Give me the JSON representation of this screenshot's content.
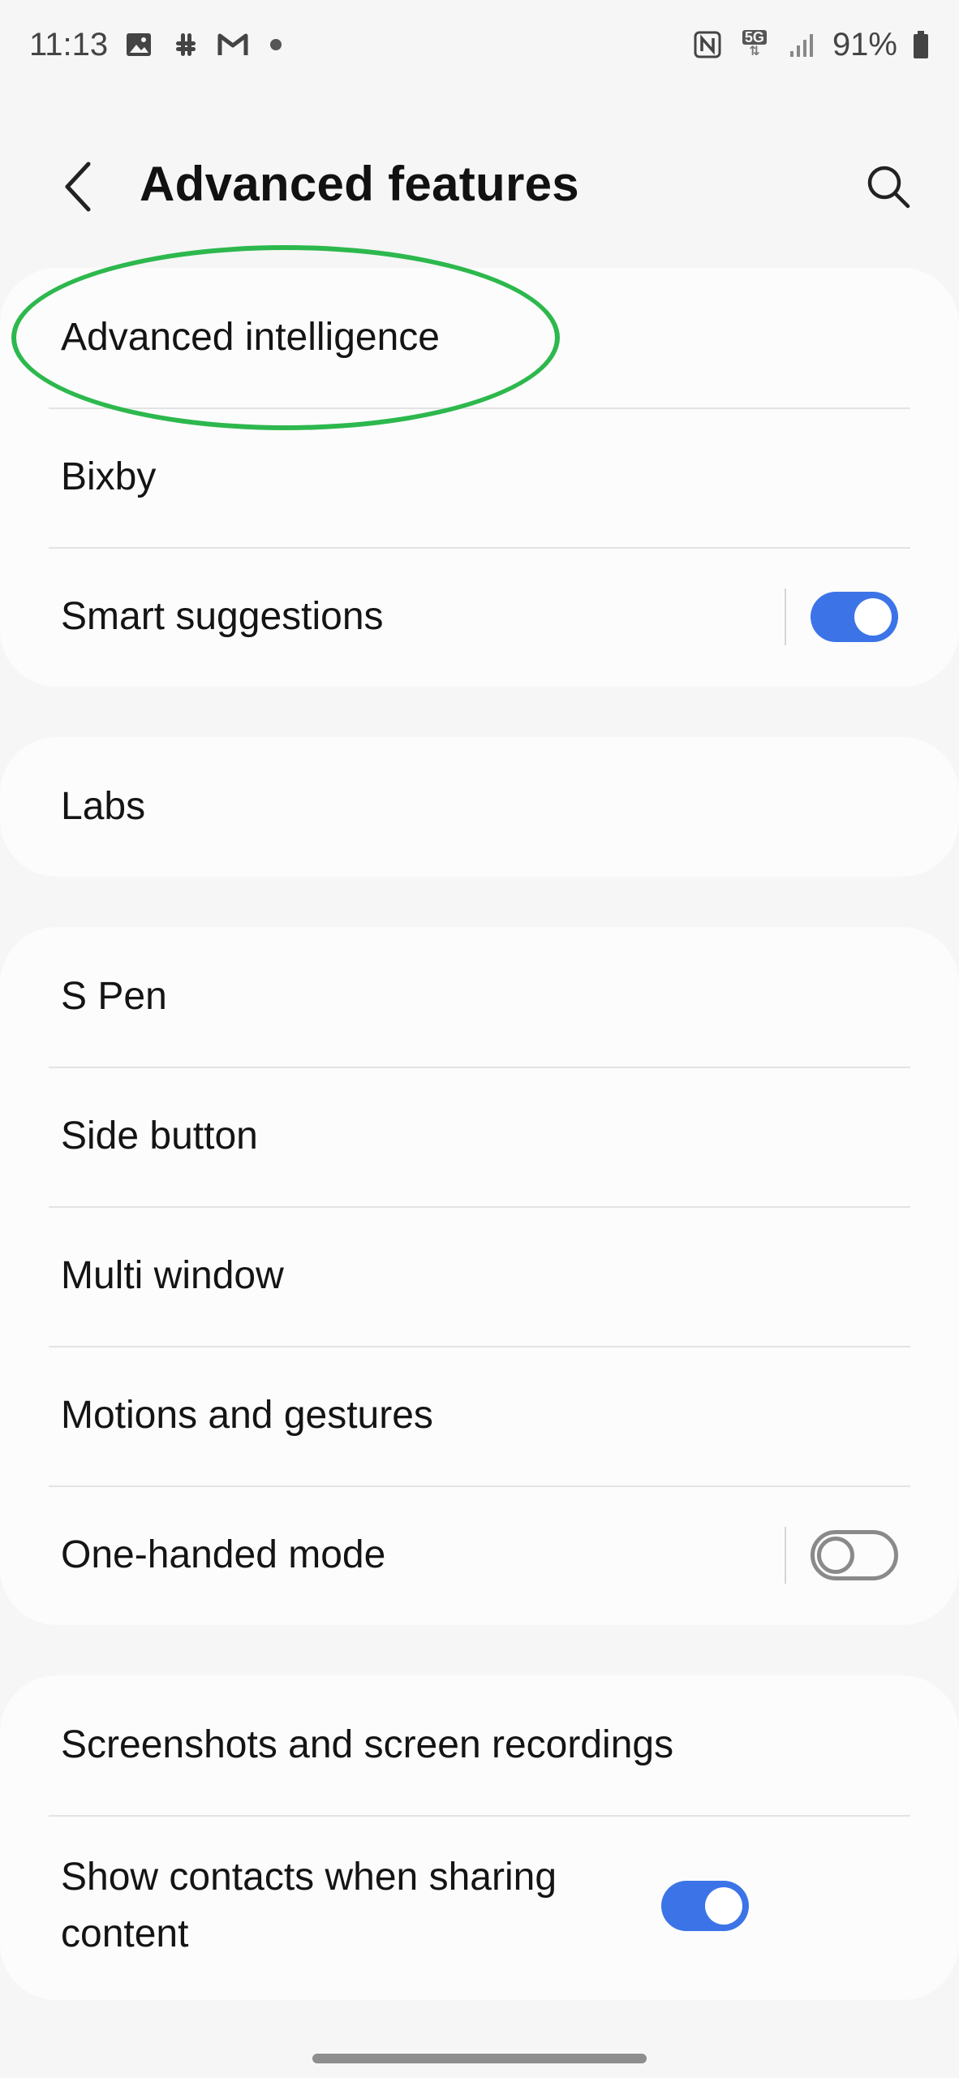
{
  "status_bar": {
    "time": "11:13",
    "left_icons": [
      "gallery-icon",
      "slack-icon",
      "gmail-icon",
      "notification-dot"
    ],
    "right_icons": [
      "nfc-icon",
      "5g-icon",
      "signal-icon",
      "battery-icon"
    ],
    "network": "5G",
    "battery": "91%"
  },
  "header": {
    "title": "Advanced features",
    "back_icon": "back-arrow-icon",
    "search_icon": "search-icon"
  },
  "groups": [
    {
      "items": [
        {
          "label": "Advanced intelligence",
          "highlighted": true
        },
        {
          "label": "Bixby"
        },
        {
          "label": "Smart suggestions",
          "toggle": true
        }
      ]
    },
    {
      "items": [
        {
          "label": "Labs"
        }
      ]
    },
    {
      "items": [
        {
          "label": "S Pen"
        },
        {
          "label": "Side button"
        },
        {
          "label": "Multi window"
        },
        {
          "label": "Motions and gestures"
        },
        {
          "label": "One-handed mode",
          "toggle": false
        }
      ]
    },
    {
      "items": [
        {
          "label": "Screenshots and screen recordings"
        },
        {
          "label": "Show contacts when sharing content",
          "toggle": true
        }
      ]
    }
  ],
  "colors": {
    "background": "#f6f6f6",
    "card": "#fcfcfc",
    "toggle_on": "#3c74e8",
    "toggle_off": "#8a8a8a",
    "highlight": "#2db84d"
  }
}
